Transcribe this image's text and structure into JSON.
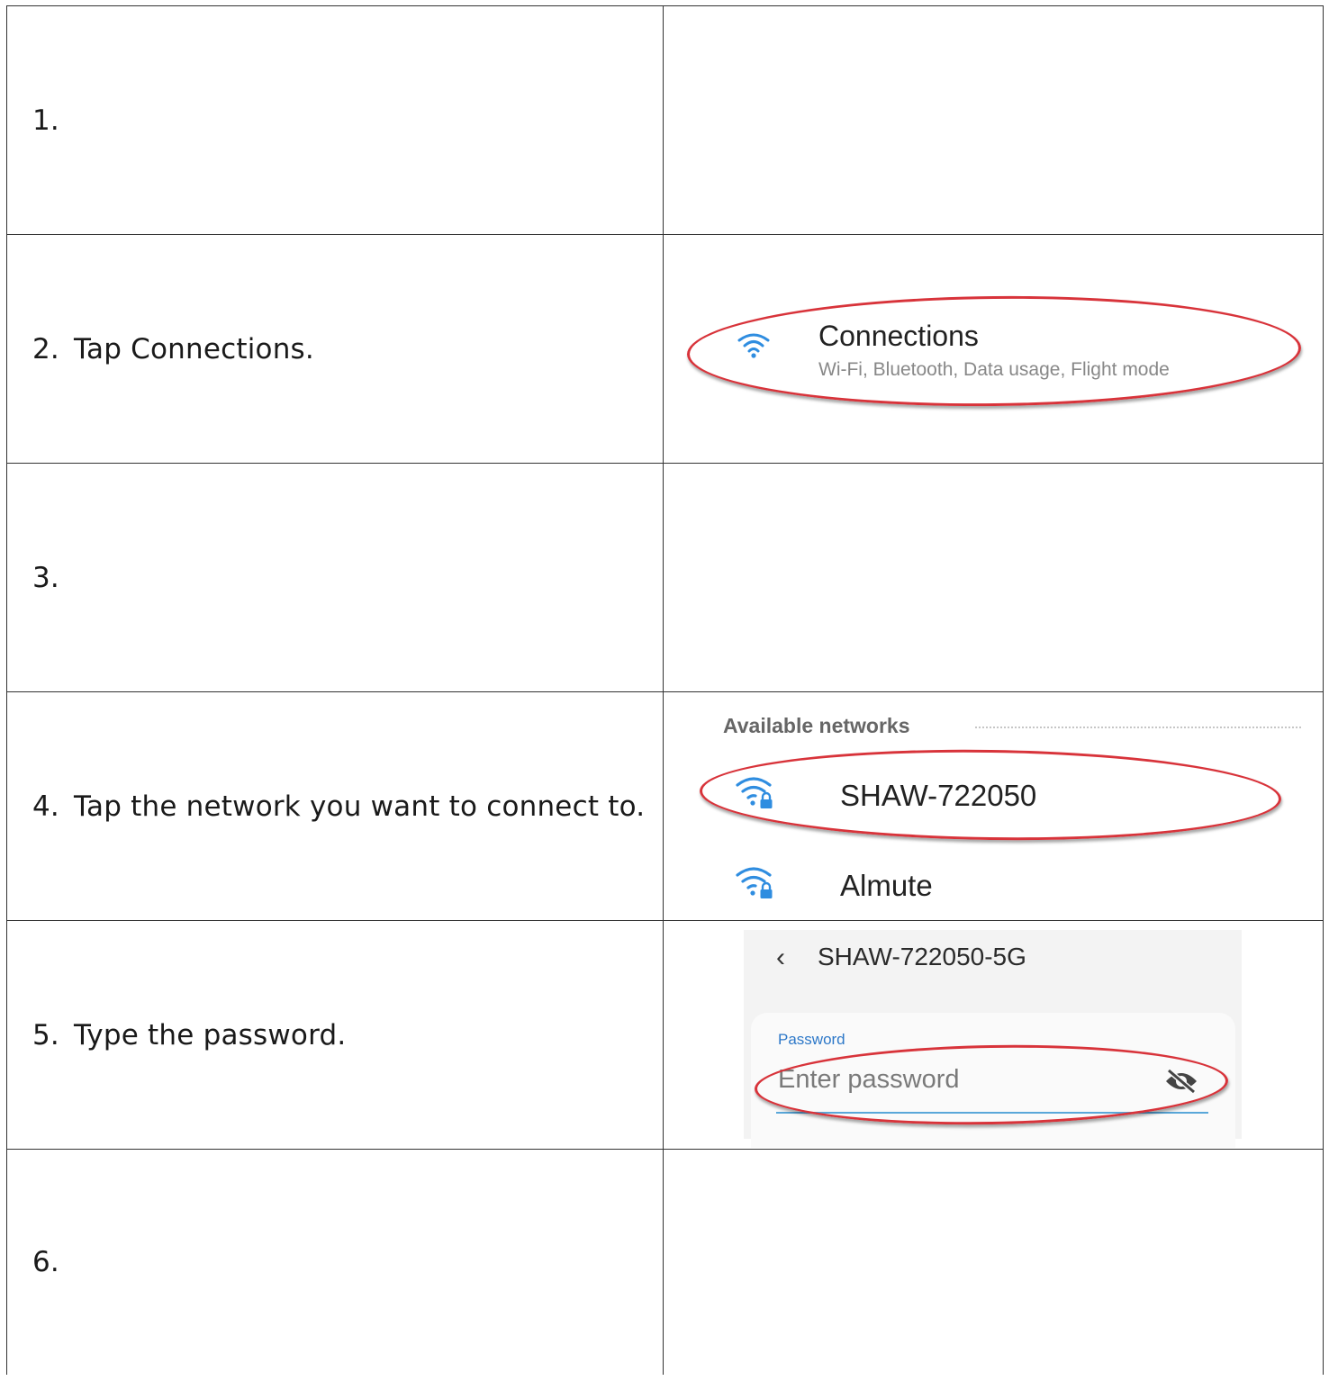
{
  "steps": [
    {
      "number": "1.",
      "text": ""
    },
    {
      "number": "2.",
      "text": "Tap Connections."
    },
    {
      "number": "3.",
      "text": ""
    },
    {
      "number": "4.",
      "text": "Tap the network you want to connect to."
    },
    {
      "number": "5.",
      "text": "Type the password."
    },
    {
      "number": "6.",
      "text": ""
    }
  ],
  "connections": {
    "title": "Connections",
    "subtitle": "Wi-Fi, Bluetooth, Data usage, Flight mode",
    "icon": "wifi-icon"
  },
  "networks": {
    "header": "Available networks",
    "items": [
      {
        "name": "SHAW-722050",
        "icon": "wifi-lock-icon",
        "highlighted": true
      },
      {
        "name": "Almute",
        "icon": "wifi-lock-icon",
        "highlighted": false
      }
    ]
  },
  "password_screen": {
    "back_icon": "chevron-left-icon",
    "ssid": "SHAW-722050-5G",
    "label": "Password",
    "placeholder": "Enter password",
    "visibility_icon": "eye-off-icon"
  },
  "colors": {
    "highlight_oval": "#d8333a",
    "wifi_blue": "#2f8de0",
    "label_blue": "#2d78c8",
    "underline": "#59a7d9"
  }
}
